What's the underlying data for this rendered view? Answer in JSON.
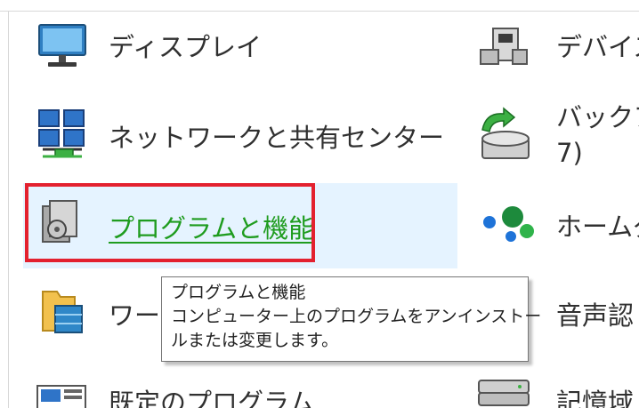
{
  "items": {
    "display": "ディスプレイ",
    "network": "ネットワークと共有センター",
    "programs": "プログラムと機能",
    "work_folders": "ワーク",
    "default_programs": "既定のプログラム",
    "devices": "デバイス",
    "backup_line1": "バックア",
    "backup_line2": "7)",
    "homegroup": "ホームグ",
    "speech": "音声認",
    "storage": "記憶域"
  },
  "tooltip": {
    "title": "プログラムと機能",
    "line1": "コンピューター上のプログラムをアンインストー",
    "line2": "ルまたは変更します。"
  },
  "colors": {
    "link": "#1f9c1f",
    "highlight_border": "#e3212f",
    "hover_bg": "#e5f3ff"
  },
  "icons": {
    "display": "monitor-icon",
    "network": "network-icon",
    "programs": "programs-icon",
    "work_folders": "work-folders-icon",
    "default_programs": "default-programs-icon",
    "devices": "device-printer-icon",
    "backup": "backup-restore-icon",
    "homegroup": "homegroup-icon",
    "speech": "speech-icon",
    "storage": "storage-icon"
  }
}
